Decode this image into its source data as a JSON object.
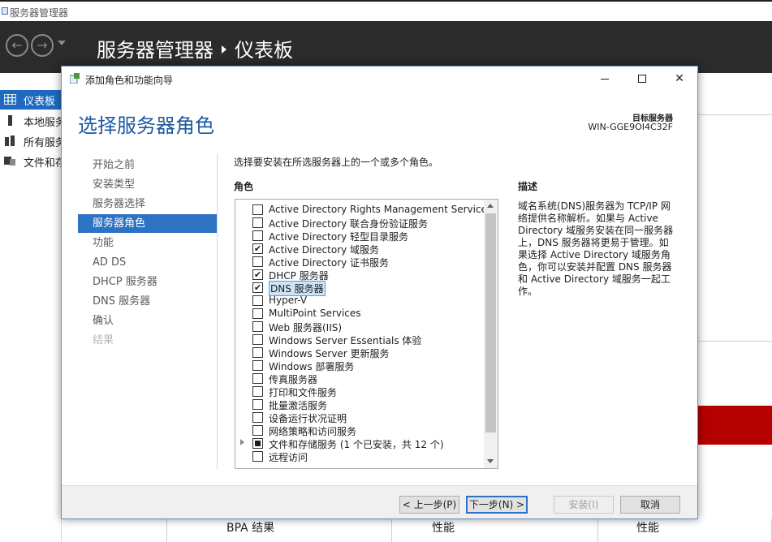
{
  "app": {
    "window_title": "服务器管理器",
    "breadcrumb_root": "服务器管理器",
    "breadcrumb_page": "仪表板"
  },
  "sidebar": {
    "items": [
      {
        "label": "仪表板",
        "active": true
      },
      {
        "label": "本地服务器"
      },
      {
        "label": "所有服务器"
      },
      {
        "label": "文件和存储服务"
      }
    ]
  },
  "tiles": {
    "bpa": "BPA 结果",
    "perf1": "性能",
    "perf2": "性能"
  },
  "wizard": {
    "title": "添加角色和功能向导",
    "heading": "选择服务器角色",
    "target_label": "目标服务器",
    "target_value": "WIN-GGE9OI4C32F",
    "instruction": "选择要安装在所选服务器上的一个或多个角色。",
    "roles_header": "角色",
    "description_header": "描述",
    "description_text": "域名系统(DNS)服务器为 TCP/IP 网络提供名称解析。如果与 Active Directory 域服务安装在同一服务器上，DNS 服务器将更易于管理。如果选择 Active Directory 域服务角色，你可以安装并配置 DNS 服务器和 Active Directory 域服务一起工作。",
    "steps": [
      {
        "label": "开始之前",
        "state": "normal"
      },
      {
        "label": "安装类型",
        "state": "normal"
      },
      {
        "label": "服务器选择",
        "state": "normal"
      },
      {
        "label": "服务器角色",
        "state": "active"
      },
      {
        "label": "功能",
        "state": "normal"
      },
      {
        "label": "AD DS",
        "state": "normal"
      },
      {
        "label": "DHCP 服务器",
        "state": "normal"
      },
      {
        "label": "DNS 服务器",
        "state": "normal"
      },
      {
        "label": "确认",
        "state": "normal"
      },
      {
        "label": "结果",
        "state": "disabled"
      }
    ],
    "roles": [
      {
        "label": "Active Directory Rights Management Services",
        "checked": false
      },
      {
        "label": "Active Directory 联合身份验证服务",
        "checked": false
      },
      {
        "label": "Active Directory 轻型目录服务",
        "checked": false
      },
      {
        "label": "Active Directory 域服务",
        "checked": true
      },
      {
        "label": "Active Directory 证书服务",
        "checked": false
      },
      {
        "label": "DHCP 服务器",
        "checked": true
      },
      {
        "label": "DNS 服务器",
        "checked": true,
        "selected": true
      },
      {
        "label": "Hyper-V",
        "checked": false
      },
      {
        "label": "MultiPoint Services",
        "checked": false
      },
      {
        "label": "Web 服务器(IIS)",
        "checked": false
      },
      {
        "label": "Windows Server Essentials 体验",
        "checked": false
      },
      {
        "label": "Windows Server 更新服务",
        "checked": false
      },
      {
        "label": "Windows 部署服务",
        "checked": false
      },
      {
        "label": "传真服务器",
        "checked": false
      },
      {
        "label": "打印和文件服务",
        "checked": false
      },
      {
        "label": "批量激活服务",
        "checked": false
      },
      {
        "label": "设备运行状况证明",
        "checked": false
      },
      {
        "label": "网络策略和访问服务",
        "checked": false
      },
      {
        "label": "文件和存储服务 (1 个已安装，共 12 个)",
        "checked": "partial",
        "expandable": true
      },
      {
        "label": "远程访问",
        "checked": false
      }
    ],
    "buttons": {
      "prev": "< 上一步(P)",
      "next": "下一步(N) >",
      "install": "安装(I)",
      "cancel": "取消"
    }
  },
  "colors": {
    "header_bg": "#2b2b2b",
    "accent": "#2e72c4",
    "heading": "#1e5aa0",
    "alert_tile": "#b50000"
  }
}
